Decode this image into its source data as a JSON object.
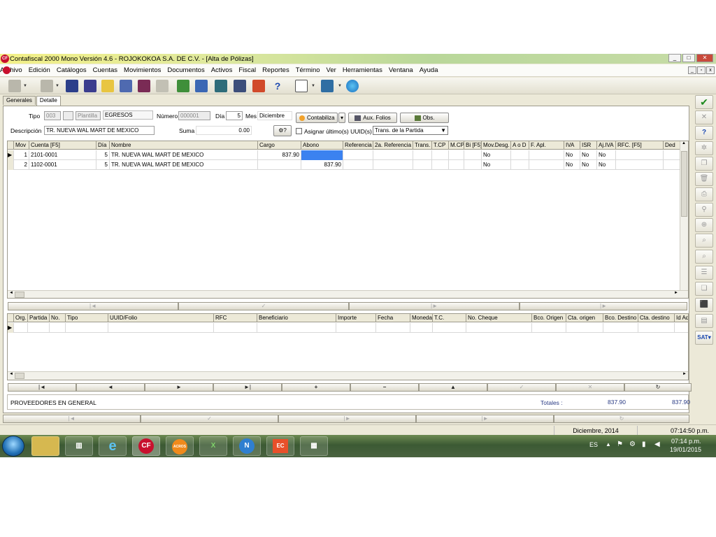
{
  "window": {
    "title": "Contafiscal 2000 Mono Versión 4.6 - ROJOKOKOA S.A. DE C.V. - [Alta de Pólizas]",
    "icon_text": "CF"
  },
  "menu": [
    "Archivo",
    "Edición",
    "Catálogos",
    "Cuentas",
    "Movimientos",
    "Documentos",
    "Activos",
    "Fiscal",
    "Reportes",
    "Término",
    "Ver",
    "Herramientas",
    "Ventana",
    "Ayuda"
  ],
  "tabs": [
    "Generales",
    "Detalle"
  ],
  "header": {
    "tipo_label": "Tipo",
    "tipo_value": "003",
    "plantilla_label": "Plantilla",
    "tipo_name": "EGRESOS",
    "numero_label": "Número",
    "numero_value": "000001",
    "dia_label": "Día",
    "dia_value": "5",
    "mes_label": "Mes",
    "mes_value": "Diciembre",
    "descripcion_label": "Descripción",
    "descripcion_value": "TR. NUEVA WAL MART DE MEXICO",
    "suma_label": "Suma",
    "suma_value": "0.00",
    "contabiliza_label": "Contabiliza",
    "aux_folios_label": "Aux. Folios",
    "obs_label": "Obs.",
    "asignar_label": "Asignar último(s) UUID(s)",
    "trans_select": "Trans. de la Partida"
  },
  "movements": {
    "columns": [
      "Mov",
      "Cuenta [F5]",
      "Día",
      "Nombre",
      "Cargo",
      "Abono",
      "Referencia",
      "2a. Referencia",
      "Trans.",
      "T.CP",
      "M.CP",
      "Bi [F5]",
      "Mov.Desg.",
      "A o D",
      "F. Apl.",
      "IVA",
      "ISR",
      "Aj.IVA",
      "RFC. [F5]",
      "Ded"
    ],
    "rows": [
      [
        "1",
        "2101-0001",
        "5",
        "TR. NUEVA WAL MART DE MEXICO",
        "837.90",
        "",
        "",
        "",
        "",
        "",
        "",
        "",
        "No",
        "",
        "",
        "No",
        "No",
        "No",
        "",
        ""
      ],
      [
        "2",
        "1102-0001",
        "5",
        "TR. NUEVA WAL MART DE MEXICO",
        "",
        "837.90",
        "",
        "",
        "",
        "",
        "",
        "",
        "No",
        "",
        "",
        "No",
        "No",
        "No",
        "",
        ""
      ]
    ]
  },
  "documents": {
    "columns": [
      "Org.",
      "Partida",
      "No.",
      "Tipo",
      "UUID/Folio",
      "RFC",
      "Beneficiario",
      "Importe",
      "Fecha",
      "Moneda",
      "T.C.",
      "No. Cheque",
      "Bco. Origen",
      "Cta. origen",
      "Bco. Destino",
      "Cta. destino",
      "Id Ad"
    ]
  },
  "footer": {
    "proveedor": "PROVEEDORES EN GENERAL",
    "totales_label": "Totales :",
    "total_cargo": "837.90",
    "total_abono": "837.90"
  },
  "status": {
    "period": "Diciembre, 2014",
    "time": "07:14:50 p.m."
  },
  "taskbar": {
    "lang": "ES",
    "clock_time": "07:14 p.m.",
    "clock_date": "19/01/2015",
    "apps": [
      "folder",
      "explorer",
      "ie",
      "CF",
      "ACROS",
      "excel",
      "N",
      "EC",
      "calc"
    ]
  }
}
